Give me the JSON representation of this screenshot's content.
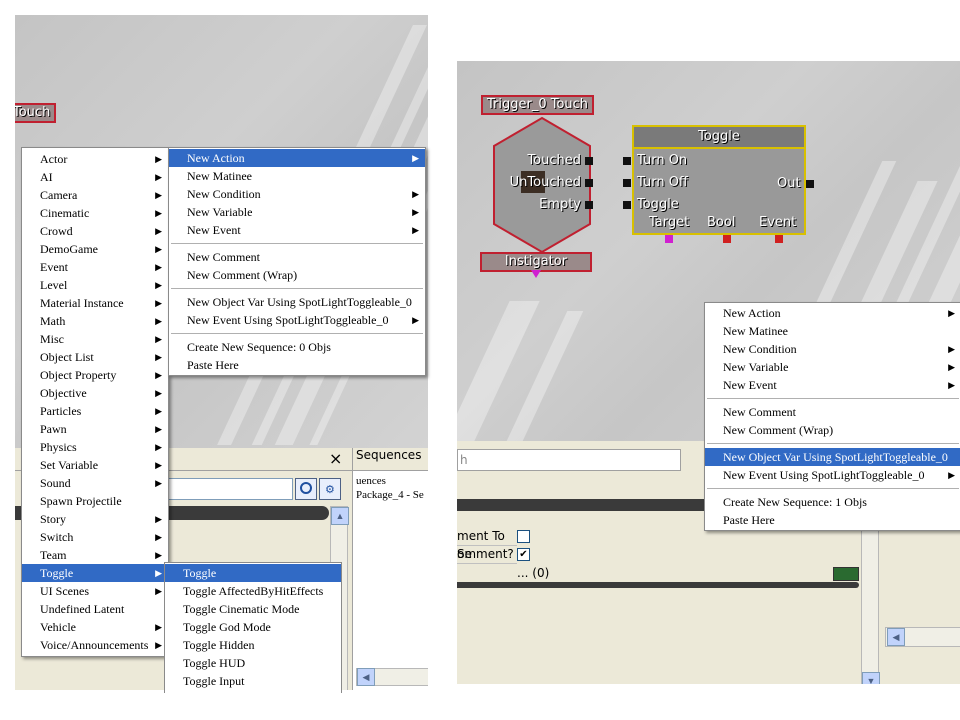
{
  "left": {
    "trigger_title": "Touch",
    "context_menu": {
      "items": [
        {
          "label": "Actor",
          "sub": true
        },
        {
          "label": "AI",
          "sub": true
        },
        {
          "label": "Camera",
          "sub": true
        },
        {
          "label": "Cinematic",
          "sub": true
        },
        {
          "label": "Crowd",
          "sub": true
        },
        {
          "label": "DemoGame",
          "sub": true
        },
        {
          "label": "Event",
          "sub": true
        },
        {
          "label": "Level",
          "sub": true
        },
        {
          "label": "Material Instance",
          "sub": true
        },
        {
          "label": "Math",
          "sub": true
        },
        {
          "label": "Misc",
          "sub": true
        },
        {
          "label": "Object List",
          "sub": true
        },
        {
          "label": "Object Property",
          "sub": true
        },
        {
          "label": "Objective",
          "sub": true
        },
        {
          "label": "Particles",
          "sub": true
        },
        {
          "label": "Pawn",
          "sub": true
        },
        {
          "label": "Physics",
          "sub": true
        },
        {
          "label": "Set Variable",
          "sub": true
        },
        {
          "label": "Sound",
          "sub": true
        },
        {
          "label": "Spawn Projectile",
          "sub": false
        },
        {
          "label": "Story",
          "sub": true
        },
        {
          "label": "Switch",
          "sub": true
        },
        {
          "label": "Team",
          "sub": true
        },
        {
          "label": "Toggle",
          "sub": true,
          "selected": true
        },
        {
          "label": "UI Scenes",
          "sub": true
        },
        {
          "label": "Undefined Latent",
          "sub": false
        },
        {
          "label": "Vehicle",
          "sub": true
        },
        {
          "label": "Voice/Announcements",
          "sub": true
        }
      ]
    },
    "new_menu": {
      "new_action": "New Action",
      "new_matinee": "New Matinee",
      "new_condition": "New Condition",
      "new_variable": "New Variable",
      "new_event": "New Event",
      "new_comment": "New Comment",
      "new_comment_wrap": "New Comment (Wrap)",
      "new_object_var": "New Object Var Using SpotLightToggleable_0",
      "new_event_using": "New Event Using SpotLightToggleable_0",
      "create_sequence": "Create New Sequence: 0 Objs",
      "paste_here": "Paste Here"
    },
    "toggle_submenu": [
      "Toggle",
      "Toggle AffectedByHitEffects",
      "Toggle Cinematic Mode",
      "Toggle God Mode",
      "Toggle Hidden",
      "Toggle HUD",
      "Toggle Input"
    ],
    "sequences": {
      "title": "Sequences",
      "row1": "uences",
      "row2": "Package_4 - Se"
    },
    "close_glyph": "×"
  },
  "right": {
    "trigger_title": "Trigger_0 Touch",
    "trigger_outputs": [
      "Touched",
      "UnTouched",
      "Empty"
    ],
    "instigator": "Instigator",
    "toggle_node": {
      "title": "Toggle",
      "inputs": [
        "Turn On",
        "Turn Off",
        "Toggle"
      ],
      "output": "Out",
      "vars": [
        "Target",
        "Bool",
        "Event"
      ]
    },
    "search_fragment": "h",
    "properties": {
      "row1": "ment To Se",
      "row2": "omment?",
      "row3": "... (0)"
    },
    "checkmark": "✔",
    "context_menu": {
      "new_action": "New Action",
      "new_matinee": "New Matinee",
      "new_condition": "New Condition",
      "new_variable": "New Variable",
      "new_event": "New Event",
      "new_comment": "New Comment",
      "new_comment_wrap": "New Comment (Wrap)",
      "new_object_var": "New Object Var Using SpotLightToggleable_0",
      "new_event_using": "New Event Using SpotLightToggleable_0",
      "create_sequence": "Create New Sequence: 1 Objs",
      "paste_here": "Paste Here"
    }
  },
  "colors": {
    "menu_highlight": "#316ac5",
    "node_border": "#c02030",
    "toggle_border": "#d8c000",
    "pin_target": "#d020d0",
    "pin_red": "#d02020"
  }
}
